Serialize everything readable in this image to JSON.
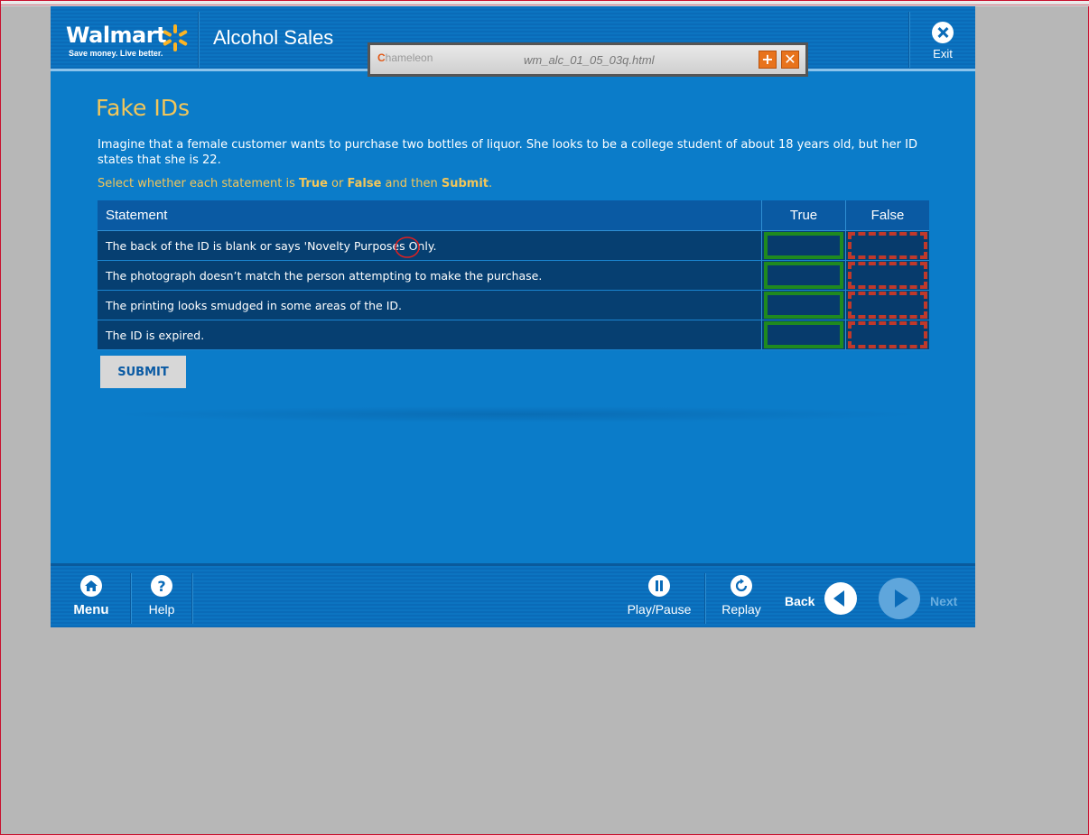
{
  "header": {
    "logo_word": "Walmart",
    "logo_tagline": "Save money. Live better.",
    "title": "Alcohol Sales",
    "exit_label": "Exit"
  },
  "popup": {
    "brand": "hameleon",
    "brand_letter": "C",
    "filename": "wm_alc_01_05_03q.html",
    "plus": "+",
    "close": "✕"
  },
  "content": {
    "page_title": "Fake IDs",
    "intro": "Imagine that a female customer wants to purchase two bottles of liquor.  She looks to be a college student of about 18 years old, but her ID states that she is 22.",
    "instruction": {
      "part1": "Select whether each statement is ",
      "true_word": "True",
      "part2": " or ",
      "false_word": "False",
      "part3": " and then ",
      "submit_word": "Submit",
      "part4": "."
    },
    "table": {
      "headers": [
        "Statement",
        "True",
        "False"
      ],
      "rows": [
        "The back of the ID is blank or says 'Novelty Purposes Only.",
        "The photograph doesn’t match the person attempting to make the purchase.",
        "The printing looks smudged in some areas of the ID.",
        "The ID is expired."
      ]
    },
    "submit_label": "SUBMIT"
  },
  "footer": {
    "menu": "Menu",
    "help": "Help",
    "play_pause": "Play/Pause",
    "replay": "Replay",
    "back": "Back",
    "next": "Next"
  },
  "colors": {
    "brand_blue": "#0b7cc9",
    "title_gold": "#f2c65a",
    "true_green": "#1f8a1f",
    "false_red": "#c0392b"
  }
}
